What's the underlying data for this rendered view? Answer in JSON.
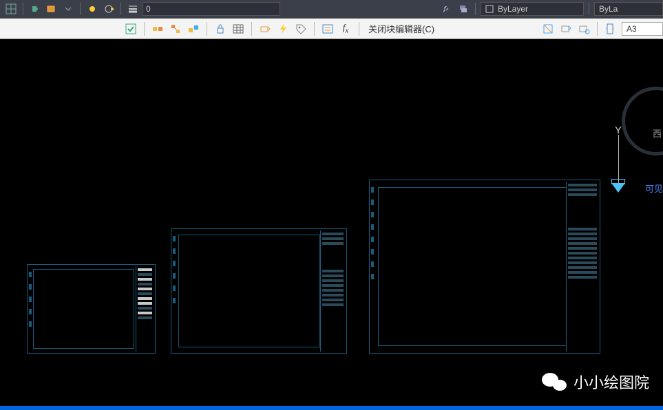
{
  "toolbar1": {
    "lineweight": "0",
    "layer_label": "ByLayer",
    "color_label": "ByLa"
  },
  "toolbar2": {
    "close_block_label": "关闭块编辑器(C)",
    "paper_size": "A3"
  },
  "compass": {
    "west": "西"
  },
  "axis": {
    "y_label": "Y",
    "visibility_hint": "可见"
  },
  "watermark": {
    "text": "小小绘图院"
  }
}
